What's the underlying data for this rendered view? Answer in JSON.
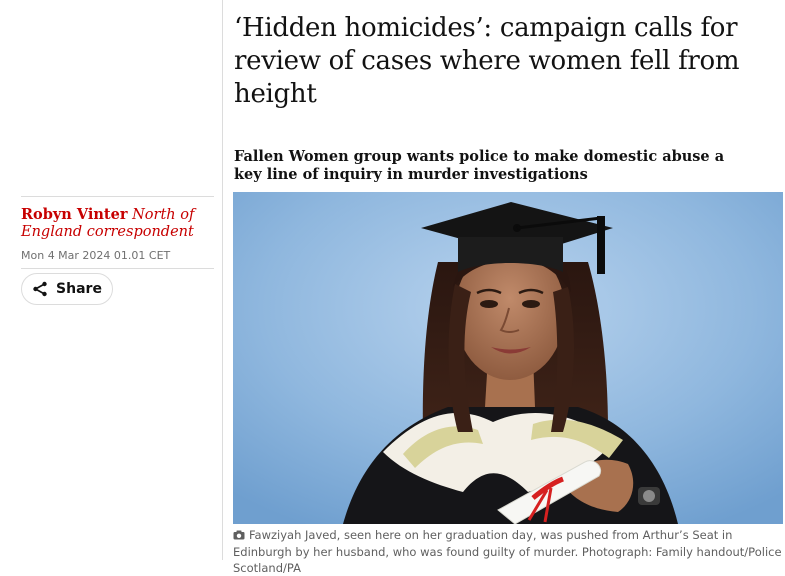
{
  "article": {
    "headline": "‘Hidden homicides’: campaign calls for review of cases where women fell from height",
    "standfirst": "Fallen Women group wants police to make domestic abuse a key line of inquiry in murder investigations"
  },
  "byline": {
    "author_name": "Robyn Vinter",
    "author_role": "North of England correspondent",
    "date": "Mon 4 Mar 2024 01.01 CET"
  },
  "share": {
    "label": "Share",
    "icon": "share-icon"
  },
  "photo": {
    "subject": "graduation-portrait",
    "caption": "Fawziyah Javed, seen here on her graduation day, was pushed from Arthur’s Seat in Edinburgh by her husband, who was found guilty of murder. Photograph: Family handout/Police Scotland/PA",
    "caption_icon": "camera-icon"
  },
  "colors": {
    "accent": "#c70000",
    "text": "#121212",
    "meta": "#707070",
    "rule": "#dcdcdc"
  }
}
